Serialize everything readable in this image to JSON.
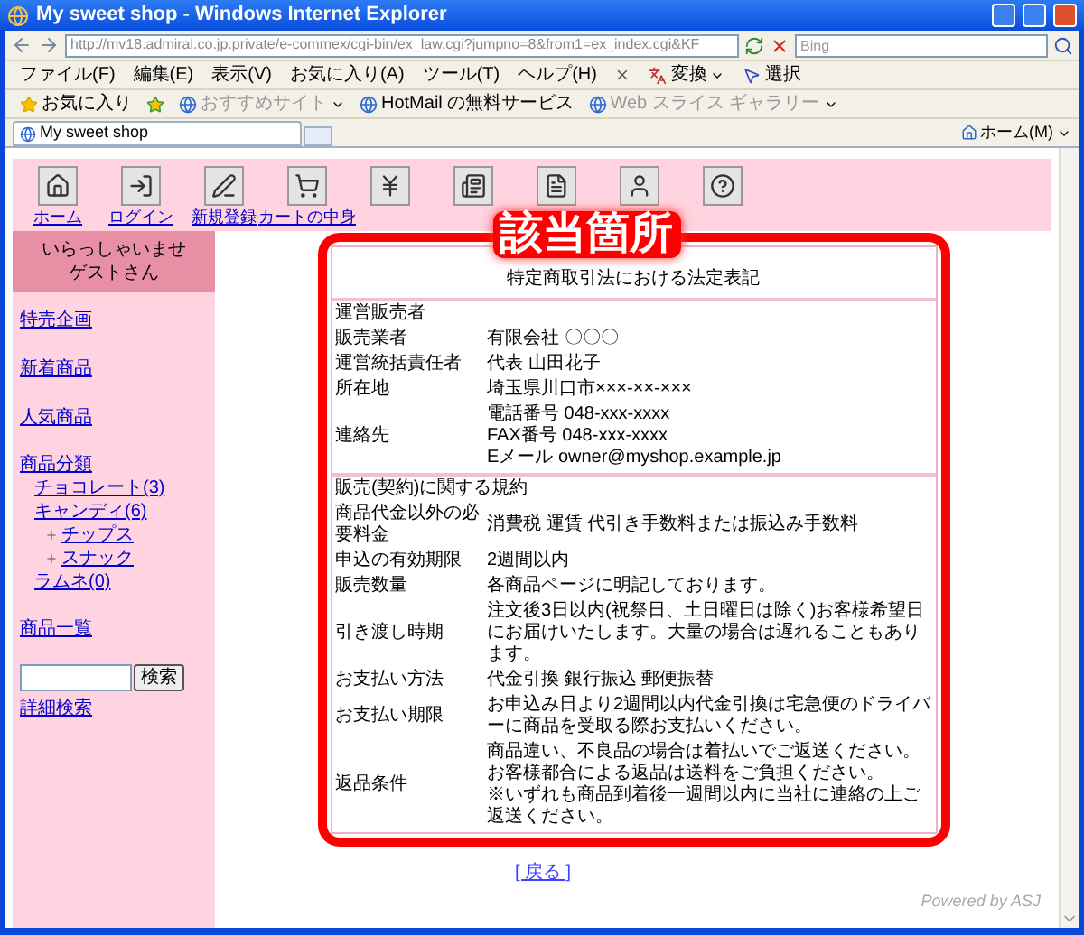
{
  "window": {
    "title": "My sweet shop - Windows Internet Explorer"
  },
  "address_bar": {
    "url": "http://mv18.admiral.co.jp.private/e-commex/cgi-bin/ex_law.cgi?jumpno=8&from1=ex_index.cgi&KF"
  },
  "search": {
    "placeholder": "Bing"
  },
  "menu": [
    "ファイル(F)",
    "編集(E)",
    "表示(V)",
    "お気に入り(A)",
    "ツール(T)",
    "ヘルプ(H)"
  ],
  "command_bar": [
    {
      "kind": "translate",
      "label": "変換",
      "dropdown": true
    },
    {
      "kind": "select",
      "label": "選択",
      "dropdown": false
    }
  ],
  "favorites_bar": {
    "favorites": "お気に入り",
    "links": [
      {
        "label": "おすすめサイト",
        "dropdown": true,
        "disabled": true
      },
      {
        "label": "HotMail の無料サービス",
        "dropdown": false,
        "disabled": false
      },
      {
        "label": "Web スライス ギャラリー",
        "dropdown": true,
        "disabled": true
      }
    ]
  },
  "tabs": [
    {
      "label": "My sweet shop",
      "selected": true
    }
  ],
  "home_button": "ホーム(M)",
  "nav": [
    {
      "kind": "home",
      "label": "ホーム"
    },
    {
      "kind": "login",
      "label": "ログイン"
    },
    {
      "kind": "signup",
      "label": "新規登録"
    },
    {
      "kind": "cart",
      "label": "カートの中身"
    },
    {
      "kind": "yen"
    },
    {
      "kind": "magazine"
    },
    {
      "kind": "document"
    },
    {
      "kind": "person"
    },
    {
      "kind": "help"
    }
  ],
  "sidebar": {
    "greeting": [
      "いらっしゃいませ",
      "ゲストさん"
    ],
    "items": [
      {
        "kind": "link",
        "label": "特売企画"
      },
      {
        "kind": "link",
        "label": "新着商品"
      },
      {
        "kind": "link",
        "label": "人気商品"
      },
      {
        "kind": "tree",
        "label": "商品分類",
        "children": [
          {
            "label": "チョコレート(3)"
          },
          {
            "label": "キャンディ(6)",
            "children": [
              {
                "label": "チップス"
              },
              {
                "label": "スナック"
              }
            ]
          },
          {
            "label": "ラムネ(0)"
          }
        ]
      },
      {
        "kind": "link",
        "label": "商品一覧"
      },
      {
        "kind": "search",
        "button": "検索"
      },
      {
        "kind": "link",
        "label": "詳細検索"
      }
    ]
  },
  "legal_table": {
    "title": "特定商取引法における法定表記",
    "sections": [
      {
        "heading": "運営販売者",
        "rows": [
          {
            "label": "販売業者",
            "lines": [
              "有限会社 〇〇〇"
            ]
          },
          {
            "label": "運営統括責任者",
            "lines": [
              "代表 山田花子"
            ]
          },
          {
            "label": "所在地",
            "lines": [
              "埼玉県川口市×××-××-×××"
            ]
          },
          {
            "label": "連絡先",
            "lines": [
              "電話番号 048-xxx-xxxx",
              "FAX番号 048-xxx-xxxx",
              "Eメール owner@myshop.example.jp"
            ]
          }
        ]
      },
      {
        "heading": "販売(契約)に関する規約",
        "rows": [
          {
            "label": "商品代金以外の必要料金",
            "lines": [
              "消費税 運賃 代引き手数料または振込み手数料"
            ]
          },
          {
            "label": "申込の有効期限",
            "lines": [
              "2週間以内"
            ]
          },
          {
            "label": "販売数量",
            "lines": [
              "各商品ページに明記しております。"
            ]
          },
          {
            "label": "引き渡し時期",
            "lines": [
              "注文後3日以内(祝祭日、土日曜日は除く)お客様希望日にお届けいたします。大量の場合は遅れることもあります。"
            ]
          },
          {
            "label": "お支払い方法",
            "lines": [
              "代金引換 銀行振込 郵便振替"
            ]
          },
          {
            "label": "お支払い期限",
            "lines": [
              "お申込み日より2週間以内代金引換は宅急便のドライバーに商品を受取る際お支払いください。"
            ]
          },
          {
            "label": "返品条件",
            "lines": [
              "商品違い、不良品の場合は着払いでご返送ください。",
              "お客様都合による返品は送料をご負担ください。",
              "※いずれも商品到着後一週間以内に当社に連絡の上ご返送ください。"
            ]
          }
        ]
      }
    ]
  },
  "annotation": {
    "label": "該当箇所"
  },
  "back_link": "[ 戻る ]",
  "footer": "Powered by ASJ"
}
